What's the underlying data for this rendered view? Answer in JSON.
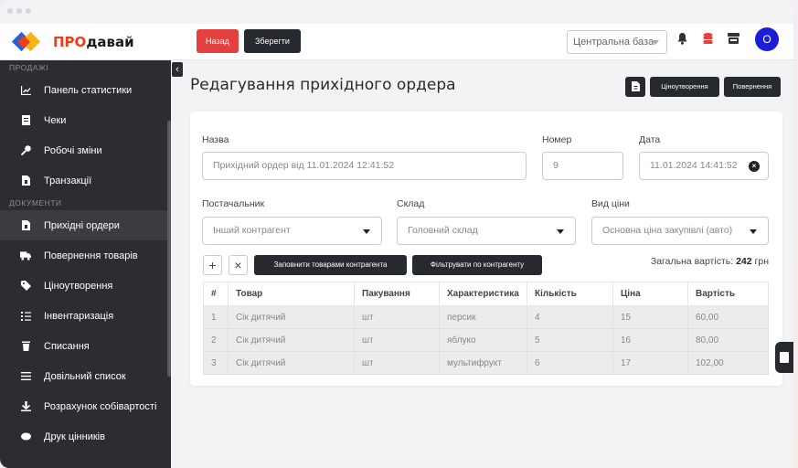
{
  "app": {
    "brand_pre": "ПРО",
    "brand_post": "давай"
  },
  "toolbar": {
    "back_label": "Назад",
    "save_label": "Зберегти"
  },
  "topbar": {
    "database_select": "Центральна база",
    "avatar_letter": "О"
  },
  "sidebar": {
    "sections": [
      {
        "title": "ПРОДАЖІ",
        "items": [
          {
            "label": "Панель статистики",
            "icon": "chart-icon"
          },
          {
            "label": "Чеки",
            "icon": "receipt-icon"
          },
          {
            "label": "Робочі зміни",
            "icon": "key-icon"
          },
          {
            "label": "Транзакції",
            "icon": "file-icon"
          }
        ]
      },
      {
        "title": "ДОКУМЕНТИ",
        "items": [
          {
            "label": "Прихідні ордери",
            "icon": "file-icon",
            "active": true
          },
          {
            "label": "Повернення товарів",
            "icon": "truck-icon"
          },
          {
            "label": "Ціноутворення",
            "icon": "tag-icon"
          },
          {
            "label": "Інвентаризація",
            "icon": "list-icon"
          },
          {
            "label": "Списання",
            "icon": "trash-icon"
          },
          {
            "label": "Довільний список",
            "icon": "menu-icon"
          },
          {
            "label": "Розрахунок собівартості",
            "icon": "calculate-icon"
          },
          {
            "label": "Друк цінників",
            "icon": "price-tag-icon"
          }
        ]
      }
    ]
  },
  "page": {
    "title": "Редагування прихідного ордера",
    "pricing_button": "Ціноутворення",
    "return_button": "Повернення"
  },
  "form": {
    "name_label": "Назва",
    "name_value": "Прихідний ордер від 11.01.2024 12:41:52",
    "number_label": "Номер",
    "number_value": "9",
    "date_label": "Дата",
    "date_value": "11.01.2024 14:41:52",
    "supplier_label": "Постачальник",
    "supplier_value": "Інший контрагент",
    "warehouse_label": "Склад",
    "warehouse_value": "Головний склад",
    "price_type_label": "Вид ціни",
    "price_type_value": "Основна ціна закупівлі (авто)"
  },
  "actions": {
    "add_symbol": "+",
    "remove_symbol": "×",
    "fill_button": "Заповнити товарами контрагента",
    "filter_button": "Фільтрувати по контрагенту",
    "total_label": "Загальна вартість:",
    "total_value": "242",
    "total_currency": "грн"
  },
  "table": {
    "headers": [
      "#",
      "Товар",
      "Пакування",
      "Характеристика",
      "Кількість",
      "Ціна",
      "Вартість"
    ],
    "rows": [
      [
        "1",
        "Сік дитячий",
        "шт",
        "персик",
        "4",
        "15",
        "60,00"
      ],
      [
        "2",
        "Сік дитячий",
        "шт",
        "яблуко",
        "5",
        "16",
        "80,00"
      ],
      [
        "3",
        "Сік дитячий",
        "шт",
        "мультифрукт",
        "6",
        "17",
        "102,00"
      ]
    ]
  },
  "colors": {
    "danger": "#e4403f",
    "dark": "#26292e",
    "sidebar": "#2b2d31",
    "avatar": "#1d1dd8",
    "accent_red": "#e8401e"
  }
}
